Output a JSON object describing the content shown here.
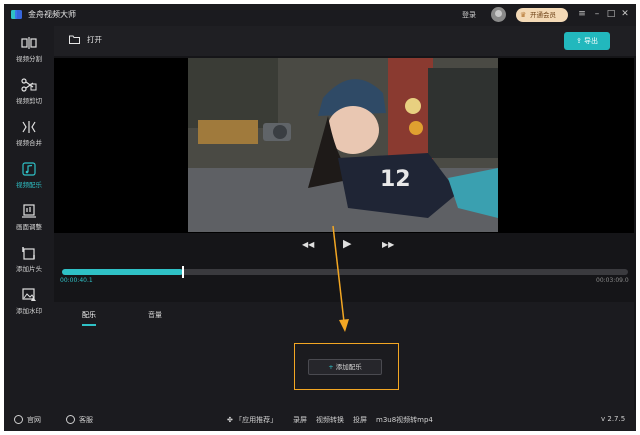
{
  "app": {
    "title": "金舟视频大师",
    "login": "登录",
    "vip_label": "开通会员"
  },
  "sidebar": {
    "items": [
      {
        "label": "视频分割",
        "icon": "split-icon"
      },
      {
        "label": "视频剪切",
        "icon": "scissors-icon"
      },
      {
        "label": "视频合并",
        "icon": "merge-icon"
      },
      {
        "label": "视频配乐",
        "icon": "music-icon",
        "active": true
      },
      {
        "label": "画面调整",
        "icon": "crop-icon"
      },
      {
        "label": "添加片头",
        "icon": "intro-icon"
      },
      {
        "label": "添加水印",
        "icon": "watermark-icon"
      }
    ]
  },
  "toolbar": {
    "open_label": "打开",
    "export_label": "导出"
  },
  "player": {
    "current_time": "00:00:40.1",
    "total_time": "00:03:09.0",
    "progress": 0.2135
  },
  "panel": {
    "tabs": [
      "配乐",
      "音量"
    ],
    "add_music_label": "添加配乐"
  },
  "footer": {
    "website": "官网",
    "support": "客服",
    "recommend": "「应用推荐」",
    "links": [
      "录屏",
      "视频转换",
      "投屏",
      "m3u8视频转mp4"
    ],
    "version": "v 2.7.5"
  },
  "colors": {
    "accent": "#2fc1c6",
    "highlight": "#f2a623",
    "vip": "#f3d9b6"
  }
}
